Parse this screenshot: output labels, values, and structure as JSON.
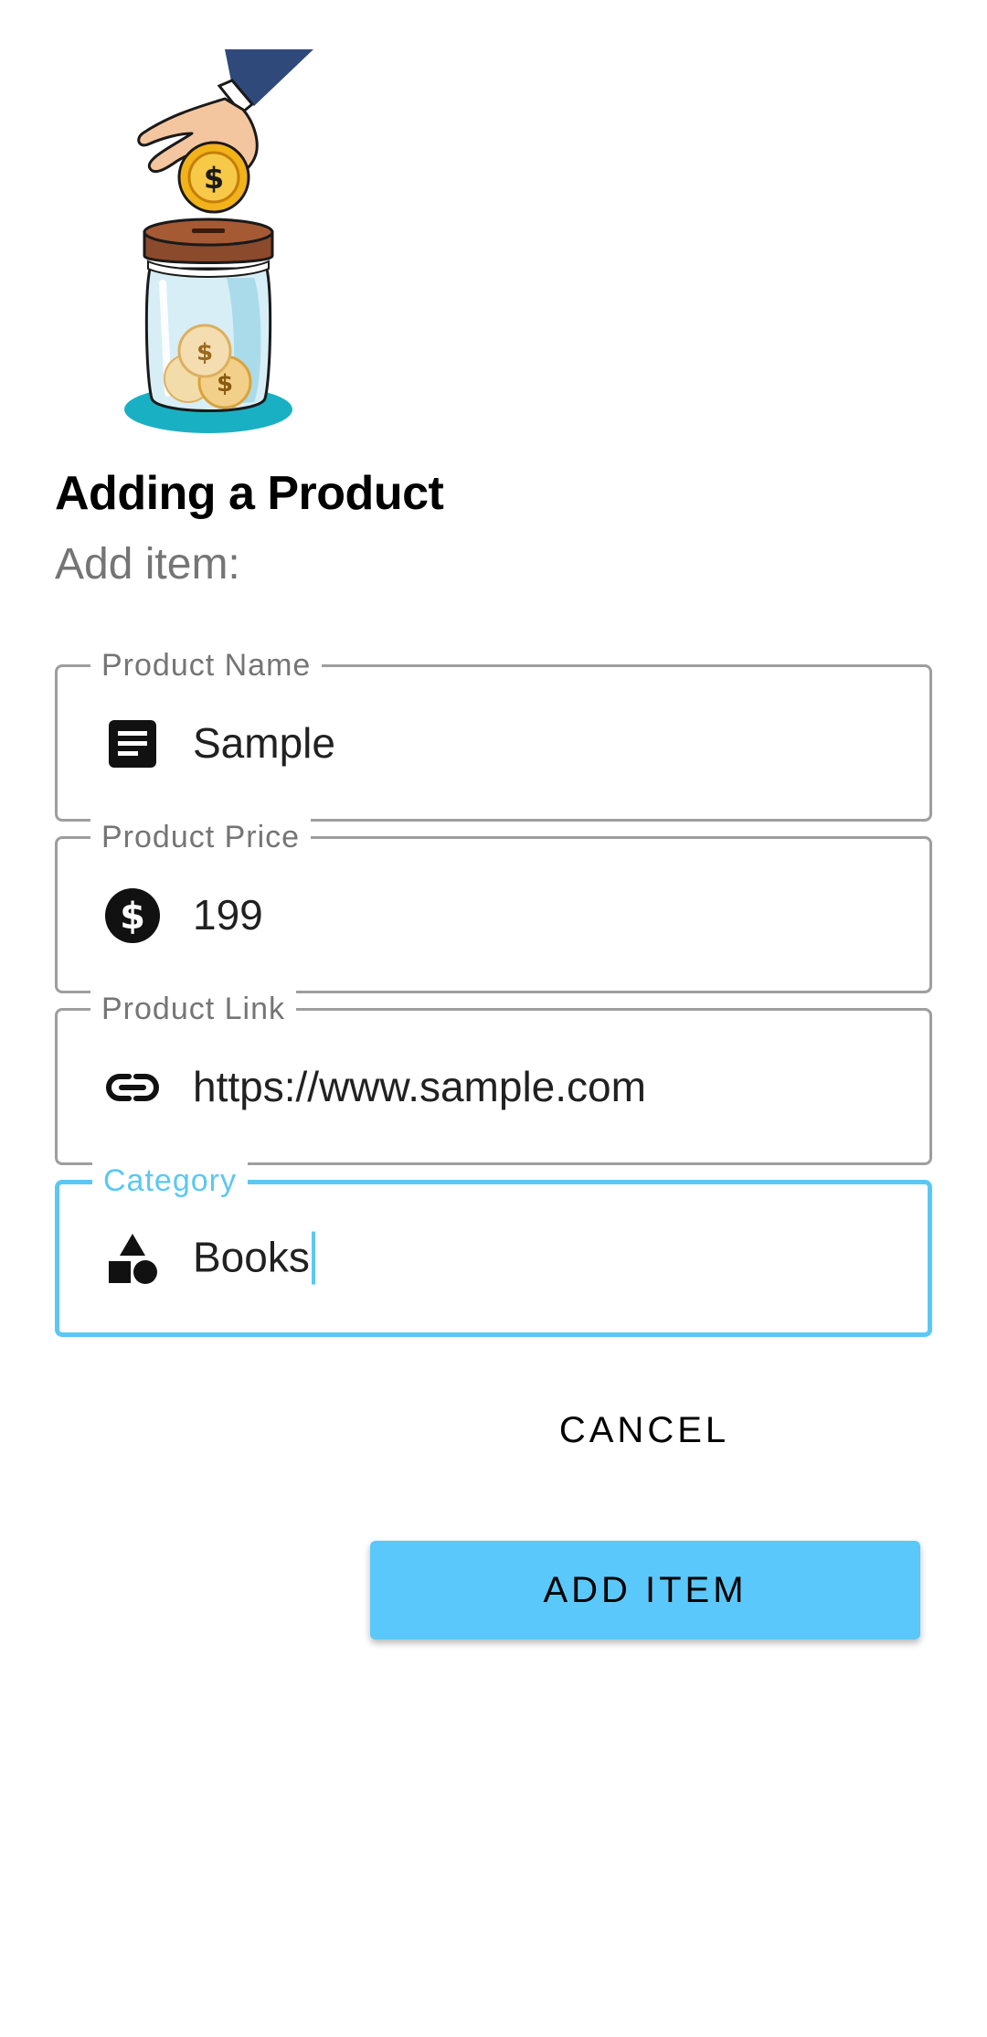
{
  "header": {
    "title": "Adding a Product",
    "subtitle": "Add item:"
  },
  "illustration": {
    "name": "coin-jar-illustration"
  },
  "form": {
    "fields": [
      {
        "label": "Product Name",
        "value": "Sample",
        "icon": "notes-icon"
      },
      {
        "label": "Product Price",
        "value": "199",
        "icon": "dollar-circle-icon"
      },
      {
        "label": "Product Link",
        "value": "https://www.sample.com",
        "icon": "link-icon"
      },
      {
        "label": "Category",
        "value": "Books",
        "icon": "category-shapes-icon",
        "focused": true
      }
    ]
  },
  "actions": {
    "cancel_label": "CANCEL",
    "add_label": "ADD ITEM"
  },
  "colors": {
    "accent": "#5ac8fa",
    "focus_border": "#5ac8f2",
    "field_border": "#9e9e9e",
    "label_gray": "#757575"
  }
}
